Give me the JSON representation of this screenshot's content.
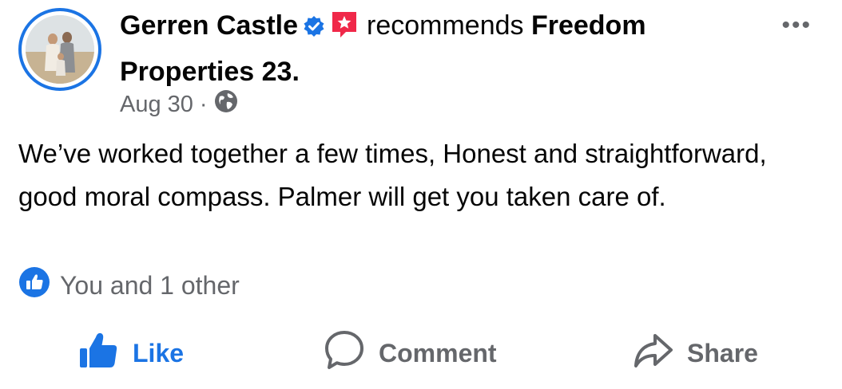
{
  "post": {
    "author": "Gerren Castle",
    "action": "recommends",
    "page": "Freedom Properties 23.",
    "date": "Aug 30",
    "separator": "·",
    "text": "We’ve worked together a few times, Honest and straightforward, good moral compass. Palmer will get you taken care of.",
    "reactions_text": "You and 1 other"
  },
  "icons": {
    "more": "more-options-icon",
    "verified": "verified-badge-icon",
    "recommend": "recommend-star-icon",
    "privacy": "globe-icon",
    "reaction": "like-reaction-icon",
    "like": "thumbs-up-icon",
    "comment": "comment-bubble-icon",
    "share": "share-arrow-icon"
  },
  "actions": {
    "like_label": "Like",
    "comment_label": "Comment",
    "share_label": "Share"
  },
  "colors": {
    "accent": "#1b74e4",
    "secondary_text": "#65676b",
    "recommend_badge": "#f02849"
  }
}
